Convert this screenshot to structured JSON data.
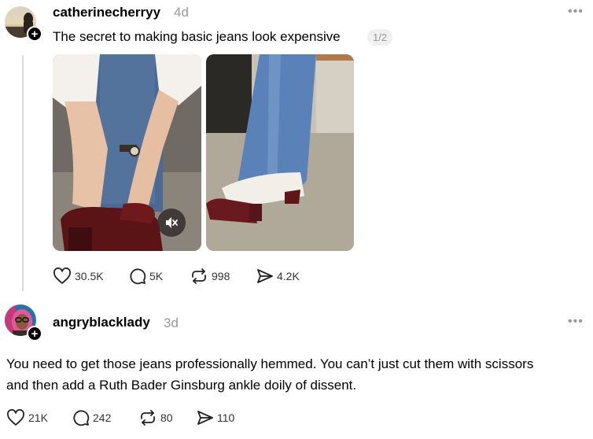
{
  "post1": {
    "username": "catherinecherryy",
    "time": "4d",
    "more": "•••",
    "text": "The secret to making basic jeans look expensive",
    "pager": "1/2",
    "stats": {
      "likes": "30.5K",
      "comments": "5K",
      "reposts": "998",
      "shares": "4.2K"
    }
  },
  "post2": {
    "username": "angryblacklady",
    "time": "3d",
    "more": "•••",
    "text_line1": "You need to get those jeans professionally hemmed. You can’t just cut them with scissors",
    "text_line2": "and then add a Ruth Bader Ginsburg ankle doily of dissent.",
    "stats": {
      "likes": "21K",
      "comments": "242",
      "reposts": "80",
      "shares": "110"
    }
  },
  "icons": {
    "plus": "+",
    "like": "heart-icon",
    "comment": "comment-icon",
    "repost": "repost-icon",
    "share": "send-icon",
    "mute": "muted-speaker-icon"
  }
}
